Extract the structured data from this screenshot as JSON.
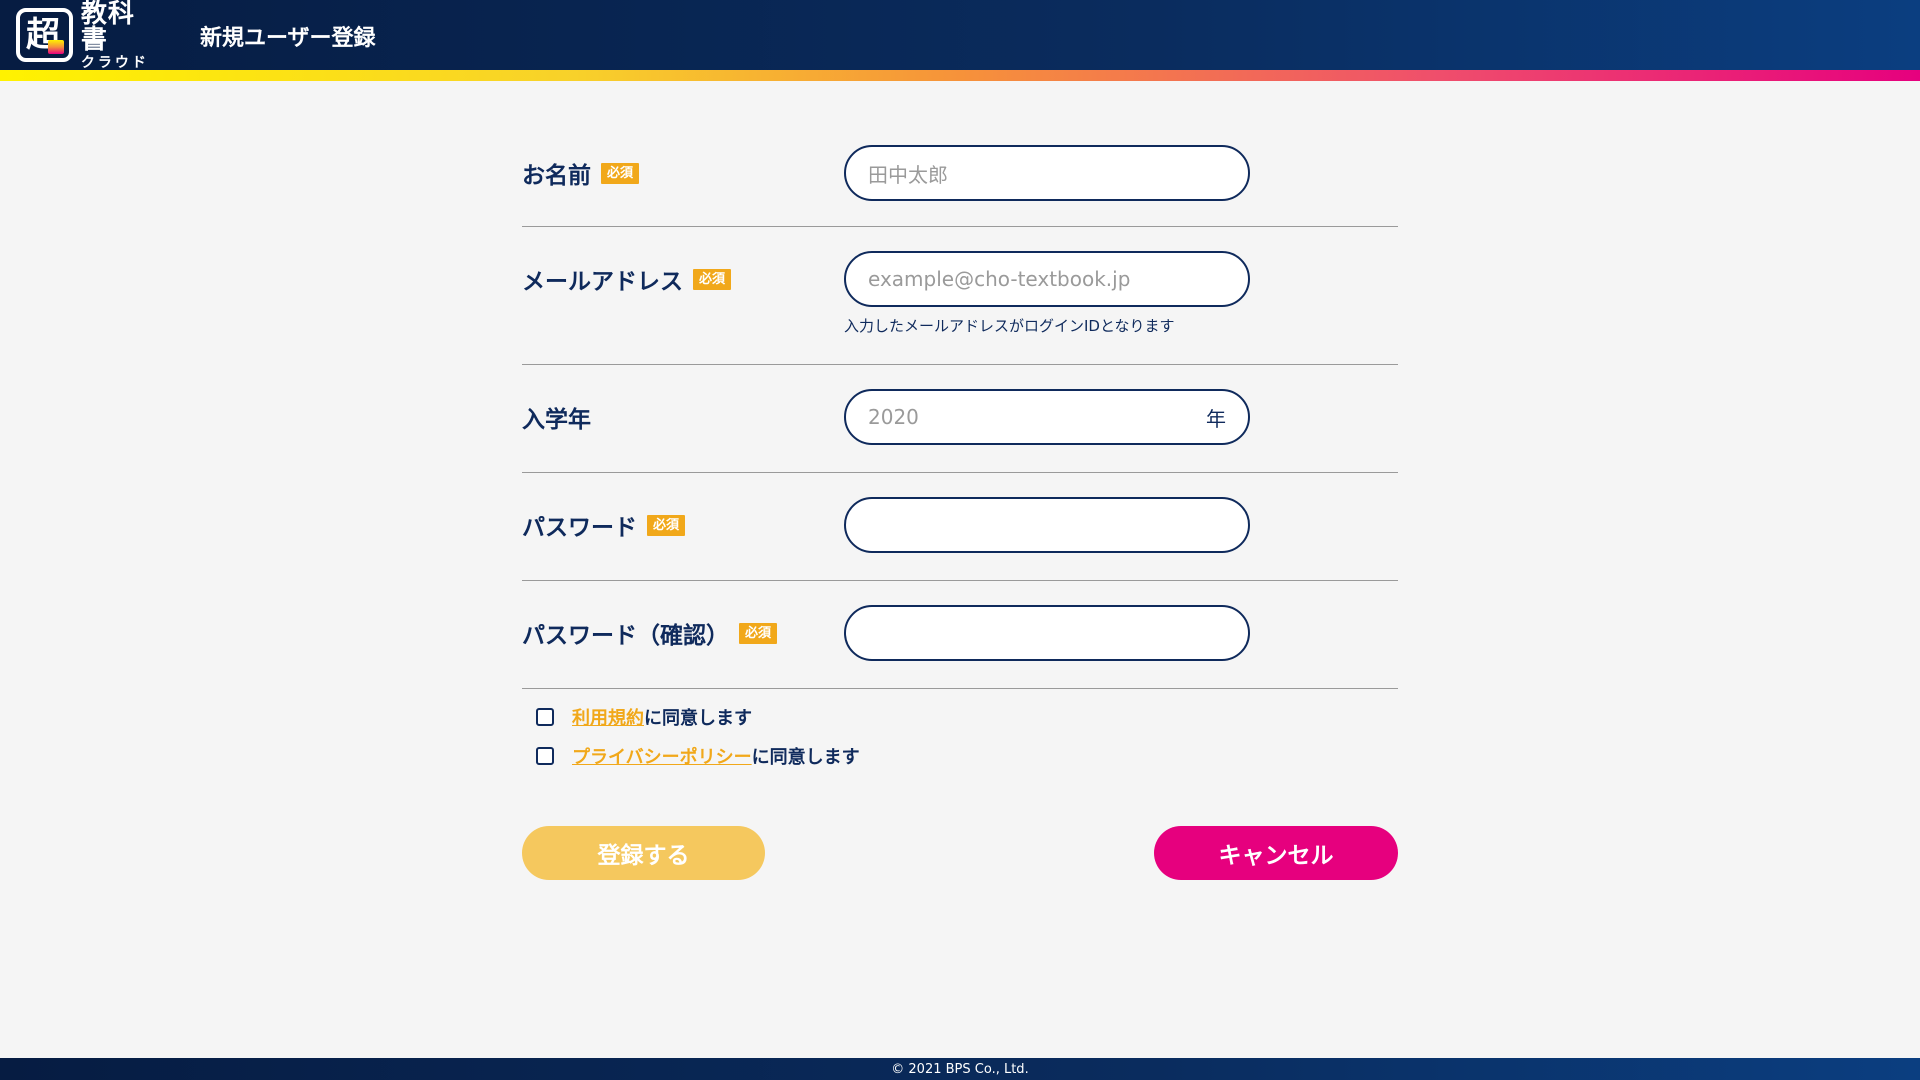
{
  "header": {
    "logo_main": "教科書",
    "logo_sub": "クラウド",
    "title": "新規ユーザー登録"
  },
  "form": {
    "required_badge": "必須",
    "fields": [
      {
        "label": "お名前",
        "placeholder": "田中太郎",
        "required": true
      },
      {
        "label": "メールアドレス",
        "placeholder": "example@cho-textbook.jp",
        "required": true,
        "hint": "入力したメールアドレスがログインIDとなります"
      },
      {
        "label": "入学年",
        "placeholder": "2020",
        "suffix": "年",
        "required": false
      },
      {
        "label": "パスワード",
        "placeholder": "",
        "required": true
      },
      {
        "label": "パスワード（確認）",
        "placeholder": "",
        "required": true
      }
    ]
  },
  "agreements": [
    {
      "link": "利用規約",
      "text": "に同意します",
      "checked": false
    },
    {
      "link": "プライバシーポリシー",
      "text": "に同意します",
      "checked": false
    }
  ],
  "buttons": {
    "register": "登録する",
    "cancel": "キャンセル"
  },
  "footer": {
    "copyright": "© 2021 BPS Co., Ltd."
  },
  "colors": {
    "navy": "#0f2a5c",
    "accent_yellow": "#f1a81a",
    "cancel_pink": "#e6007e",
    "register_disabled": "#f5c85e"
  }
}
